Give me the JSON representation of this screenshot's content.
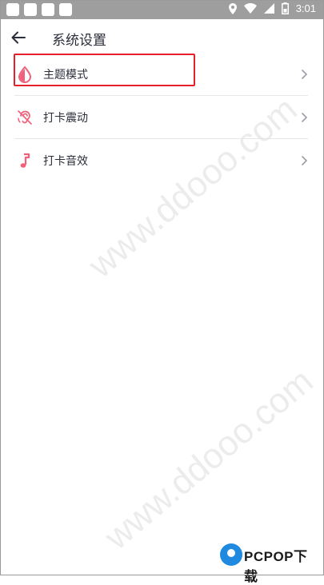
{
  "status_bar": {
    "time": "3:01"
  },
  "header": {
    "title": "系统设置"
  },
  "settings": [
    {
      "label": "主题模式",
      "icon": "water-drop-icon"
    },
    {
      "label": "打卡震动",
      "icon": "vibration-off-icon"
    },
    {
      "label": "打卡音效",
      "icon": "music-note-icon"
    }
  ],
  "watermark": {
    "text": "www.ddooo.com"
  },
  "logo": {
    "text": "PCPOP下载"
  },
  "colors": {
    "accent": "#f0607a",
    "highlight": "#e6202a",
    "status_bar": "#9e9e9e"
  }
}
